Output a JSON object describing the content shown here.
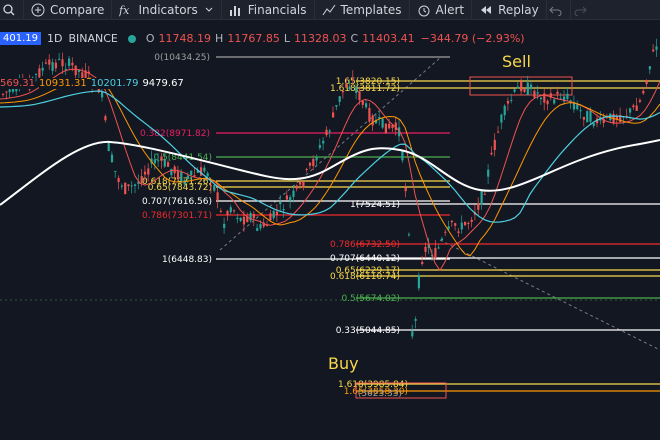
{
  "toolbar": {
    "compare": "Compare",
    "indicators": "Indicators",
    "financials": "Financials",
    "templates": "Templates",
    "alert": "Alert",
    "replay": "Replay"
  },
  "symbol": {
    "interval": "1D",
    "exchange": "BINANCE",
    "price_tag": "401.19",
    "ohlc": {
      "o_label": "O",
      "o": "11748.19",
      "h_label": "H",
      "h": "11767.85",
      "l_label": "L",
      "l": "11328.03",
      "c_label": "C",
      "c": "11403.41",
      "change": "−344.79 (−2.93%)"
    }
  },
  "ma_values": [
    "569.31",
    "10931.31",
    "10201.79",
    "9479.67"
  ],
  "annotations": {
    "sell": "Sell",
    "buy": "Buy"
  },
  "colors": {
    "bg": "#131722",
    "up": "#26a69a",
    "down": "#ef5350",
    "fib_white": "#ffffff",
    "fib_red": "#ef2b2b",
    "fib_yellow": "#f7d94c",
    "fib_green": "#4caf50",
    "fib_pink": "#e91e63",
    "fib_orange": "#ff9800",
    "fib_gray": "#9e9e9e"
  },
  "chart_data": {
    "type": "candlestick",
    "left_fib_levels": [
      {
        "label": "0(10434.25)",
        "color": "#9e9e9e"
      },
      {
        "label": "0.382(8971.82)",
        "color": "#e91e63"
      },
      {
        "label": "0.5(8441.54)",
        "color": "#4caf50"
      },
      {
        "label": "0.618(7971.26)",
        "color": "#f7d94c"
      },
      {
        "label": "0.65(7843.72)",
        "color": "#f7d94c"
      },
      {
        "label": "0.707(7616.56)",
        "color": "#ffffff"
      },
      {
        "label": "0.786(7301.71)",
        "color": "#ef2b2b"
      },
      {
        "label": "1(6448.83)",
        "color": "#ffffff"
      }
    ],
    "right_fib_levels": [
      {
        "label": "1.65(3820.15)",
        "color": "#f7d94c"
      },
      {
        "label": "1.618(3811.72)",
        "color": "#f7d94c"
      },
      {
        "label": "1(7524.51)",
        "color": "#ffffff"
      },
      {
        "label": "0.786(6732.50)",
        "color": "#ef2b2b"
      },
      {
        "label": "0.707(6440.12)",
        "color": "#ffffff"
      },
      {
        "label": "0.65(6229.17)",
        "color": "#f7d94c"
      },
      {
        "label": "0.618(6110.74)",
        "color": "#f7d94c"
      },
      {
        "label": "0.5(5674.02)",
        "color": "#4caf50"
      },
      {
        "label": "0.33(5044.85)",
        "color": "#ffffff"
      },
      {
        "label": "1.618(3985.84)",
        "color": "#f7d94c"
      },
      {
        "label": "1.65(3858.30)",
        "color": "#ff9800"
      },
      {
        "label": "(3623.33)",
        "color": "#9e9e9e"
      }
    ]
  }
}
